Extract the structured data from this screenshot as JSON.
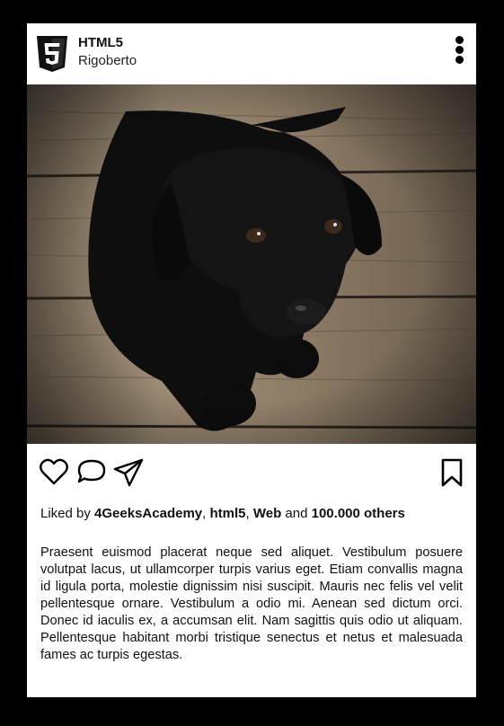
{
  "post": {
    "author": "HTML5",
    "location": "Rigoberto",
    "logo_icon": "html5-logo-icon",
    "menu_icon": "more-vertical-icon",
    "image_alt": "Black puppy on wooden floor",
    "actions": {
      "like_icon": "heart-icon",
      "comment_icon": "comment-icon",
      "share_icon": "send-icon",
      "save_icon": "bookmark-icon"
    },
    "likes": {
      "prefix": "Liked by",
      "user1": "4GeeksAcademy",
      "sep1": ",",
      "user2": "html5",
      "sep2": ",",
      "user3": "Web",
      "and": "and",
      "others": "100.000 others"
    },
    "description": "Praesent euismod placerat neque sed aliquet. Vestibulum posuere volutpat lacus, ut ullamcorper turpis varius eget. Etiam convallis magna id ligula porta, molestie dignissim nisi suscipit. Mauris nec felis vel velit pellentesque ornare. Vestibulum a odio mi. Aenean sed dictum orci. Donec id iaculis ex, a accumsan elit. Nam sagittis quis odio ut aliquam. Pellentesque habitant morbi tristique senectus et netus et malesuada fames ac turpis egestas."
  },
  "colors": {
    "background": "#000000",
    "card": "#ffffff",
    "html5_badge": "#111111",
    "floor": "#8c7b66"
  }
}
